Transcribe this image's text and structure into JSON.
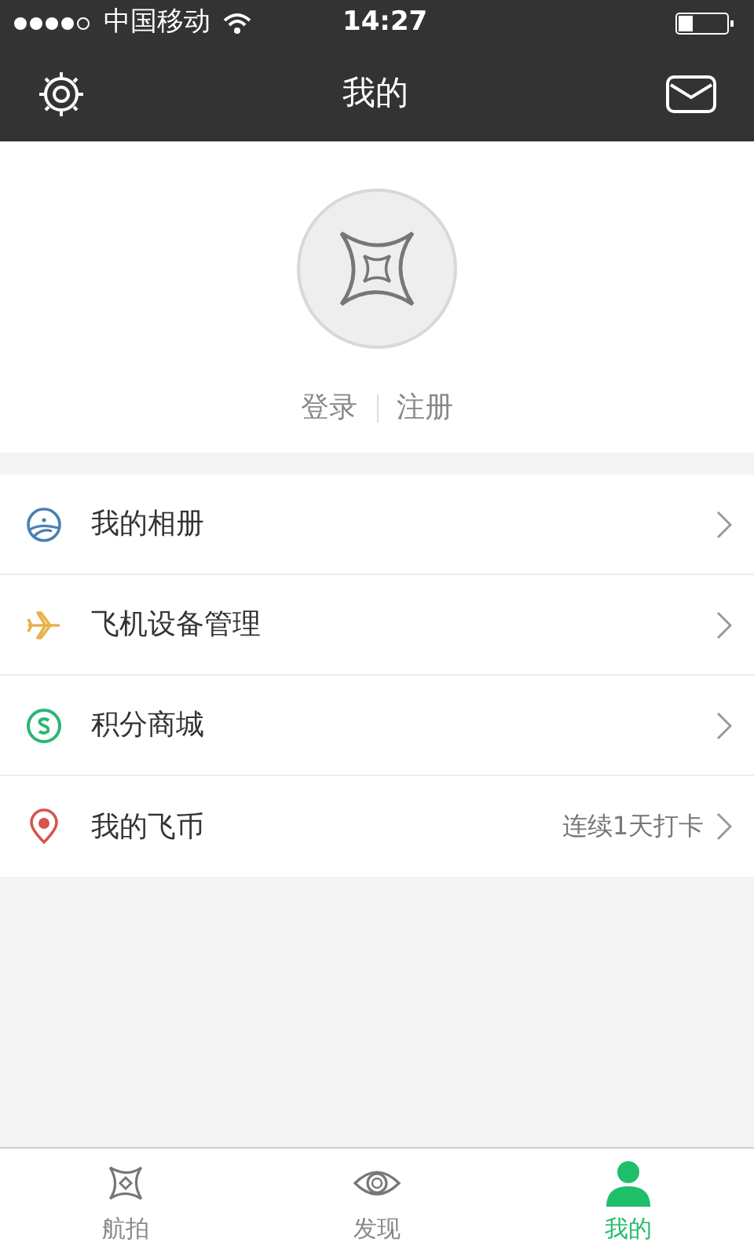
{
  "status_bar": {
    "carrier": "中国移动",
    "time": "14:27"
  },
  "header": {
    "title": "我的"
  },
  "profile": {
    "login": "登录",
    "register": "注册"
  },
  "menu": [
    {
      "kind": "album",
      "label": "我的相册"
    },
    {
      "kind": "plane",
      "label": "飞机设备管理"
    },
    {
      "kind": "coin",
      "label": "积分商城"
    },
    {
      "kind": "location",
      "label": "我的飞币",
      "detail": "连续1天打卡"
    }
  ],
  "tabs": [
    {
      "kind": "drone",
      "label": "航拍",
      "selected": false
    },
    {
      "kind": "eye",
      "label": "发现",
      "selected": false
    },
    {
      "kind": "person",
      "label": "我的",
      "selected": true
    }
  ]
}
